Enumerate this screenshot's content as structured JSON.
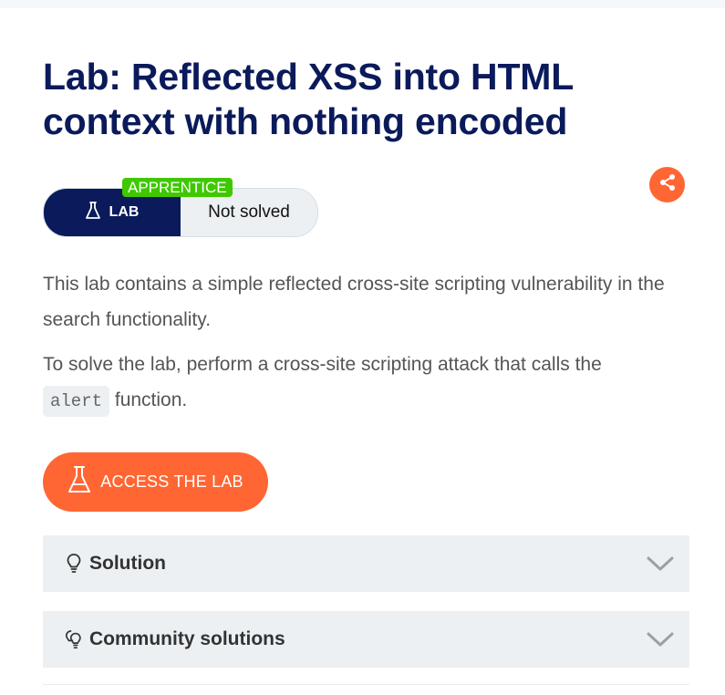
{
  "title": "Lab: Reflected XSS into HTML context with nothing encoded",
  "level_badge": "APPRENTICE",
  "lab_label": "LAB",
  "status": "Not solved",
  "description": {
    "paragraph1": "This lab contains a simple reflected cross-site scripting vulnerability in the search functionality.",
    "paragraph2_before": "To solve the lab, perform a cross-site scripting attack that calls the",
    "paragraph2_code": "alert",
    "paragraph2_after": "function."
  },
  "access_button_label": "ACCESS THE LAB",
  "accordions": [
    {
      "label": "Solution",
      "icon": "lightbulb-icon"
    },
    {
      "label": "Community solutions",
      "icon": "lightbulbs-icon"
    }
  ],
  "colors": {
    "title": "#0a1a5a",
    "accent": "#ff6633",
    "badge_green": "#3fc800",
    "panel": "#ecf0f3"
  }
}
